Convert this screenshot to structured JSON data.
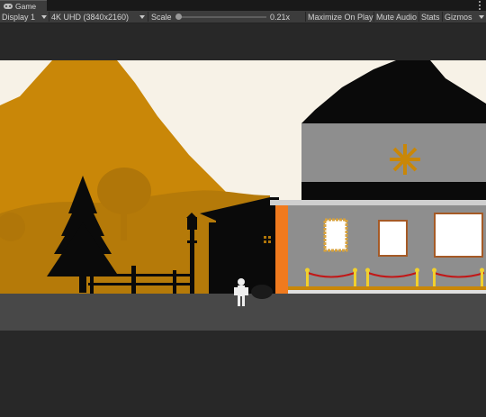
{
  "tab": {
    "title": "Game",
    "icon": "gamepad-icon"
  },
  "toolbar": {
    "display": "Display 1",
    "resolution": "4K UHD (3840x2160)",
    "scale_label": "Scale",
    "scale_value": "0.21x",
    "scale_fraction": 0.02,
    "maximize": "Maximize On Play",
    "mute": "Mute Audio",
    "stats": "Stats",
    "gizmos": "Gizmos"
  },
  "colors": {
    "sky": "#f7f2e7",
    "mountain": "#c98708",
    "hill": "#b57a09",
    "house_wall": "#8e8e8e",
    "door_accent": "#f07a1e",
    "rope": "#c21717",
    "post": "#f2d02c"
  }
}
